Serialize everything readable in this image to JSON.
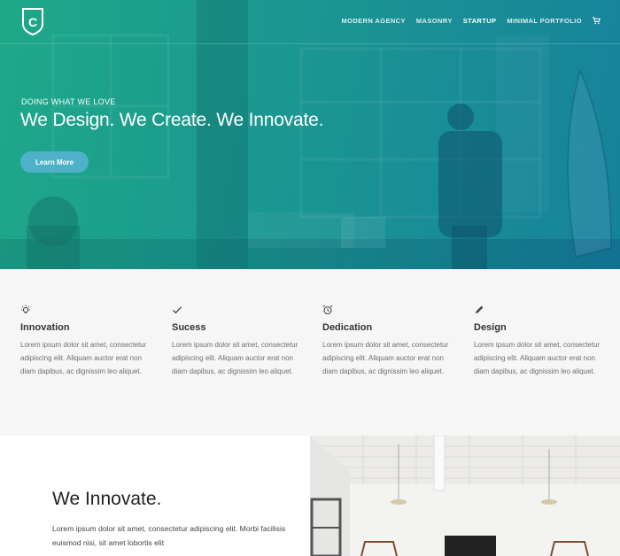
{
  "nav": {
    "logo_letter": "C",
    "items": [
      {
        "label": "MODERN AGENCY",
        "active": false
      },
      {
        "label": "MASONRY",
        "active": false
      },
      {
        "label": "STARTUP",
        "active": true
      },
      {
        "label": "MINIMAL PORTFOLIO",
        "active": false
      }
    ],
    "cart_icon": "cart-icon"
  },
  "hero": {
    "subtitle": "DOING WHAT WE LOVE",
    "title": "We Design. We Create. We Innovate.",
    "button_label": "Learn More",
    "colors": {
      "gradient_start": "#1fa882",
      "gradient_end": "#1877a8",
      "button": "#4fb1c9"
    }
  },
  "features": [
    {
      "icon": "lightbulb-icon",
      "title": "Innovation",
      "text": "Lorem ipsum dolor sit amet, consectetur adipiscing elit. Aliquam auctor erat non diam dapibus, ac dignissim leo aliquet."
    },
    {
      "icon": "checkmark-icon",
      "title": "Sucess",
      "text": "Lorem ipsum dolor sit amet, consectetur adipiscing elit. Aliquam auctor erat non diam dapibus, ac dignissim leo aliquet."
    },
    {
      "icon": "alarm-clock-icon",
      "title": "Dedication",
      "text": "Lorem ipsum dolor sit amet, consectetur adipiscing elit. Aliquam auctor erat non diam dapibus, ac dignissim leo aliquet."
    },
    {
      "icon": "pencil-icon",
      "title": "Design",
      "text": "Lorem ipsum dolor sit amet, consectetur adipiscing elit. Aliquam auctor erat non diam dapibus, ac dignissim leo aliquet."
    }
  ],
  "innovate": {
    "title": "We Innovate.",
    "text": "Lorem ipsum dolor sit amet, consectetur adipiscing elit. Morbi facilisis euismod nisi, sit amet lobortis elit"
  }
}
